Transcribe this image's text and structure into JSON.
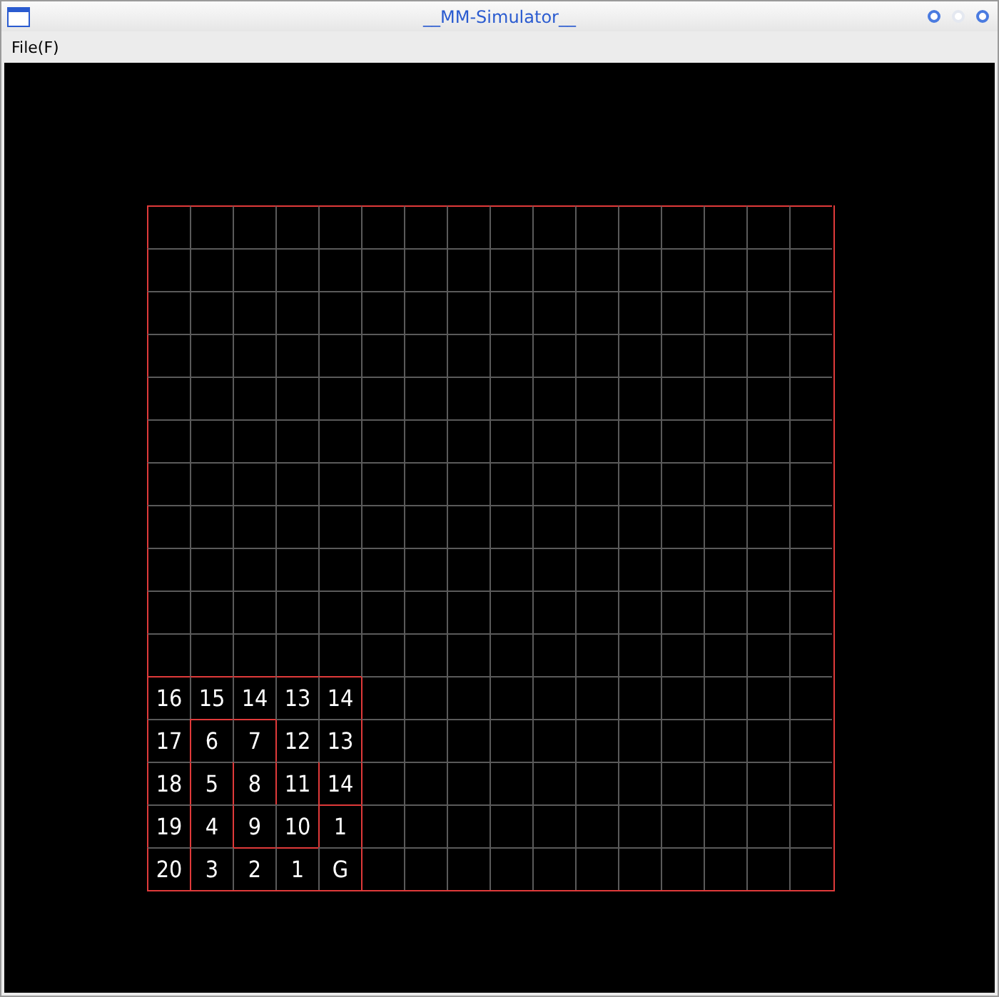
{
  "window": {
    "title": "__MM-Simulator__"
  },
  "menu": [
    {
      "label": "File(F)"
    }
  ],
  "maze": {
    "rows": [
      {
        "cells": [
          {},
          {},
          {},
          {},
          {},
          {},
          {},
          {},
          {},
          {},
          {},
          {},
          {},
          {},
          {},
          {}
        ]
      },
      {
        "cells": [
          {},
          {},
          {},
          {},
          {},
          {},
          {},
          {},
          {},
          {},
          {},
          {},
          {},
          {},
          {},
          {}
        ]
      },
      {
        "cells": [
          {},
          {},
          {},
          {},
          {},
          {},
          {},
          {},
          {},
          {},
          {},
          {},
          {},
          {},
          {},
          {}
        ]
      },
      {
        "cells": [
          {},
          {},
          {},
          {},
          {},
          {},
          {},
          {},
          {},
          {},
          {},
          {},
          {},
          {},
          {},
          {}
        ]
      },
      {
        "cells": [
          {},
          {},
          {},
          {},
          {},
          {},
          {},
          {},
          {},
          {},
          {},
          {},
          {},
          {},
          {},
          {}
        ]
      },
      {
        "cells": [
          {},
          {},
          {},
          {},
          {},
          {},
          {},
          {},
          {},
          {},
          {},
          {},
          {},
          {},
          {},
          {}
        ]
      },
      {
        "cells": [
          {},
          {},
          {},
          {},
          {},
          {},
          {},
          {},
          {},
          {},
          {},
          {},
          {},
          {},
          {},
          {}
        ]
      },
      {
        "cells": [
          {},
          {},
          {},
          {},
          {},
          {},
          {},
          {},
          {},
          {},
          {},
          {},
          {},
          {},
          {},
          {}
        ]
      },
      {
        "cells": [
          {},
          {},
          {},
          {},
          {},
          {},
          {},
          {},
          {},
          {},
          {},
          {},
          {},
          {},
          {},
          {}
        ]
      },
      {
        "cells": [
          {},
          {},
          {},
          {},
          {},
          {},
          {},
          {},
          {},
          {},
          {},
          {},
          {},
          {},
          {},
          {}
        ]
      },
      {
        "cells": [
          {},
          {},
          {},
          {},
          {},
          {},
          {},
          {},
          {},
          {},
          {},
          {},
          {},
          {},
          {},
          {}
        ]
      },
      {
        "cells": [
          {
            "label": "16",
            "wall_top": true
          },
          {
            "label": "15",
            "wall_top": true
          },
          {
            "label": "14",
            "wall_top": true
          },
          {
            "label": "13",
            "wall_top": true
          },
          {
            "label": "14",
            "wall_top": true
          },
          {
            "wall_left": true
          },
          {},
          {},
          {},
          {},
          {},
          {},
          {},
          {},
          {},
          {}
        ]
      },
      {
        "cells": [
          {
            "label": "17"
          },
          {
            "label": "6",
            "wall_top": true,
            "wall_left": true
          },
          {
            "label": "7",
            "wall_top": true
          },
          {
            "label": "12",
            "wall_left": true
          },
          {
            "label": "13"
          },
          {
            "wall_left": true
          },
          {},
          {},
          {},
          {},
          {},
          {},
          {},
          {},
          {},
          {}
        ]
      },
      {
        "cells": [
          {
            "label": "18"
          },
          {
            "label": "5",
            "wall_left": true
          },
          {
            "label": "8",
            "wall_left": true
          },
          {
            "label": "11",
            "wall_left": true
          },
          {
            "label": "14",
            "wall_left": true
          },
          {
            "wall_left": true
          },
          {},
          {},
          {},
          {},
          {},
          {},
          {},
          {},
          {},
          {}
        ]
      },
      {
        "cells": [
          {
            "label": "19"
          },
          {
            "label": "4",
            "wall_left": true
          },
          {
            "label": "9",
            "wall_left": true
          },
          {
            "label": "10"
          },
          {
            "label": "1",
            "wall_top": true,
            "wall_left": true
          },
          {
            "wall_left": true
          },
          {},
          {},
          {},
          {},
          {},
          {},
          {},
          {},
          {},
          {}
        ]
      },
      {
        "cells": [
          {
            "label": "20"
          },
          {
            "label": "3",
            "wall_left": true
          },
          {
            "label": "2",
            "wall_top": true
          },
          {
            "label": "1",
            "wall_top": true
          },
          {
            "label": "G"
          },
          {
            "wall_left": true
          },
          {},
          {},
          {},
          {},
          {},
          {},
          {},
          {},
          {},
          {}
        ]
      }
    ]
  }
}
